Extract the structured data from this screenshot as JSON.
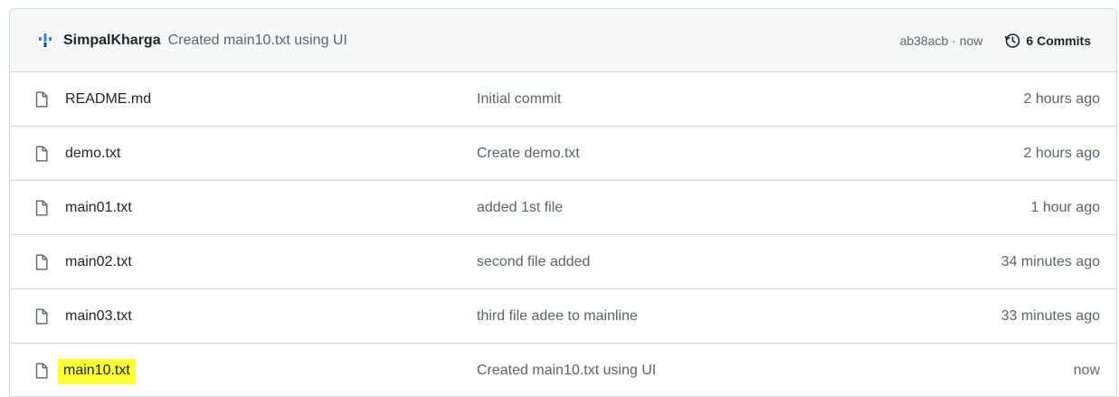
{
  "header": {
    "author": "SimpalKharga",
    "commit_message": "Created main10.txt using UI",
    "sha_time": "ab38acb · now",
    "commits_label": "6 Commits"
  },
  "files": [
    {
      "name": "README.md",
      "message": "Initial commit",
      "time": "2 hours ago"
    },
    {
      "name": "demo.txt",
      "message": "Create demo.txt",
      "time": "2 hours ago"
    },
    {
      "name": "main01.txt",
      "message": "added 1st file",
      "time": "1 hour ago"
    },
    {
      "name": "main02.txt",
      "message": "second file added",
      "time": "34 minutes ago"
    },
    {
      "name": "main03.txt",
      "message": "third file adee to mainline",
      "time": "33 minutes ago"
    },
    {
      "name": "main10.txt",
      "message": "Created main10.txt using UI",
      "time": "now",
      "highlighted": true
    }
  ],
  "colors": {
    "highlight": "#ffff33",
    "border": "#d0d7de",
    "header_bg": "#f6f8fa",
    "muted_text": "#59636e"
  },
  "icons": {
    "avatar": "author-avatar-icon",
    "history": "history-clock-icon",
    "file": "file-icon"
  }
}
